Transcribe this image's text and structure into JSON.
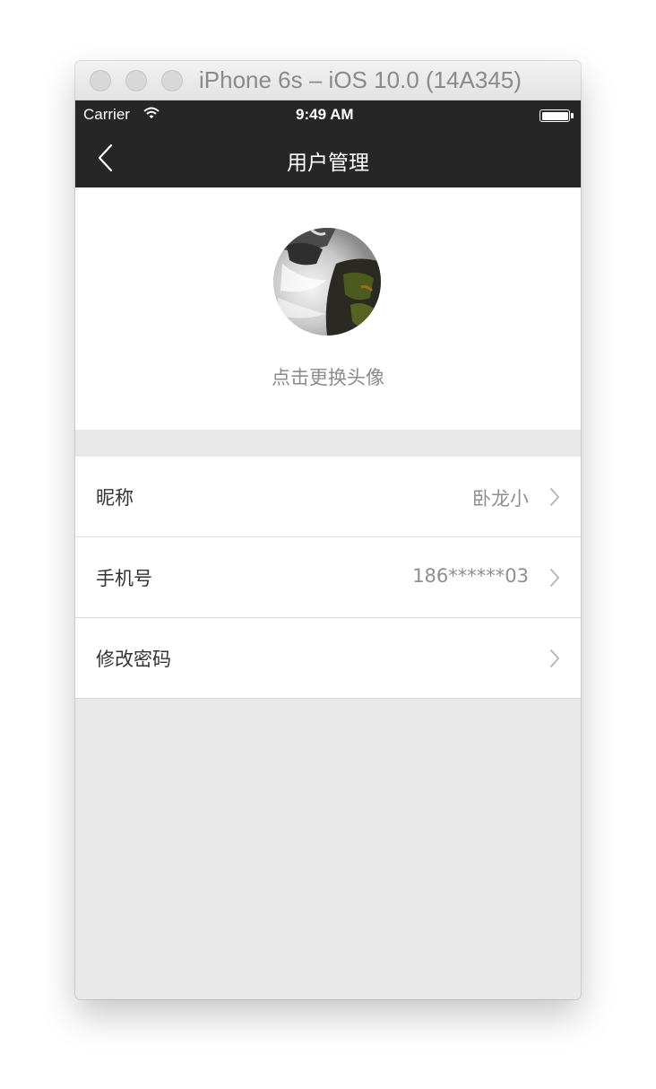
{
  "window": {
    "title": "iPhone 6s – iOS 10.0 (14A345)"
  },
  "status_bar": {
    "carrier": "Carrier",
    "time": "9:49 AM",
    "icons": [
      "wifi-icon",
      "battery-icon"
    ]
  },
  "nav_bar": {
    "back_icon": "chevron-left-icon",
    "title": "用户管理"
  },
  "profile": {
    "avatar": "waterfall-photo",
    "hint": "点击更换头像"
  },
  "settings": {
    "rows": [
      {
        "label": "昵称",
        "value": "卧龙小"
      },
      {
        "label": "手机号",
        "value": "186******03"
      },
      {
        "label": "修改密码",
        "value": ""
      }
    ]
  },
  "colors": {
    "nav_background": "#262626",
    "page_background": "#e9e9e9",
    "secondary_text": "#8c8c8c"
  }
}
